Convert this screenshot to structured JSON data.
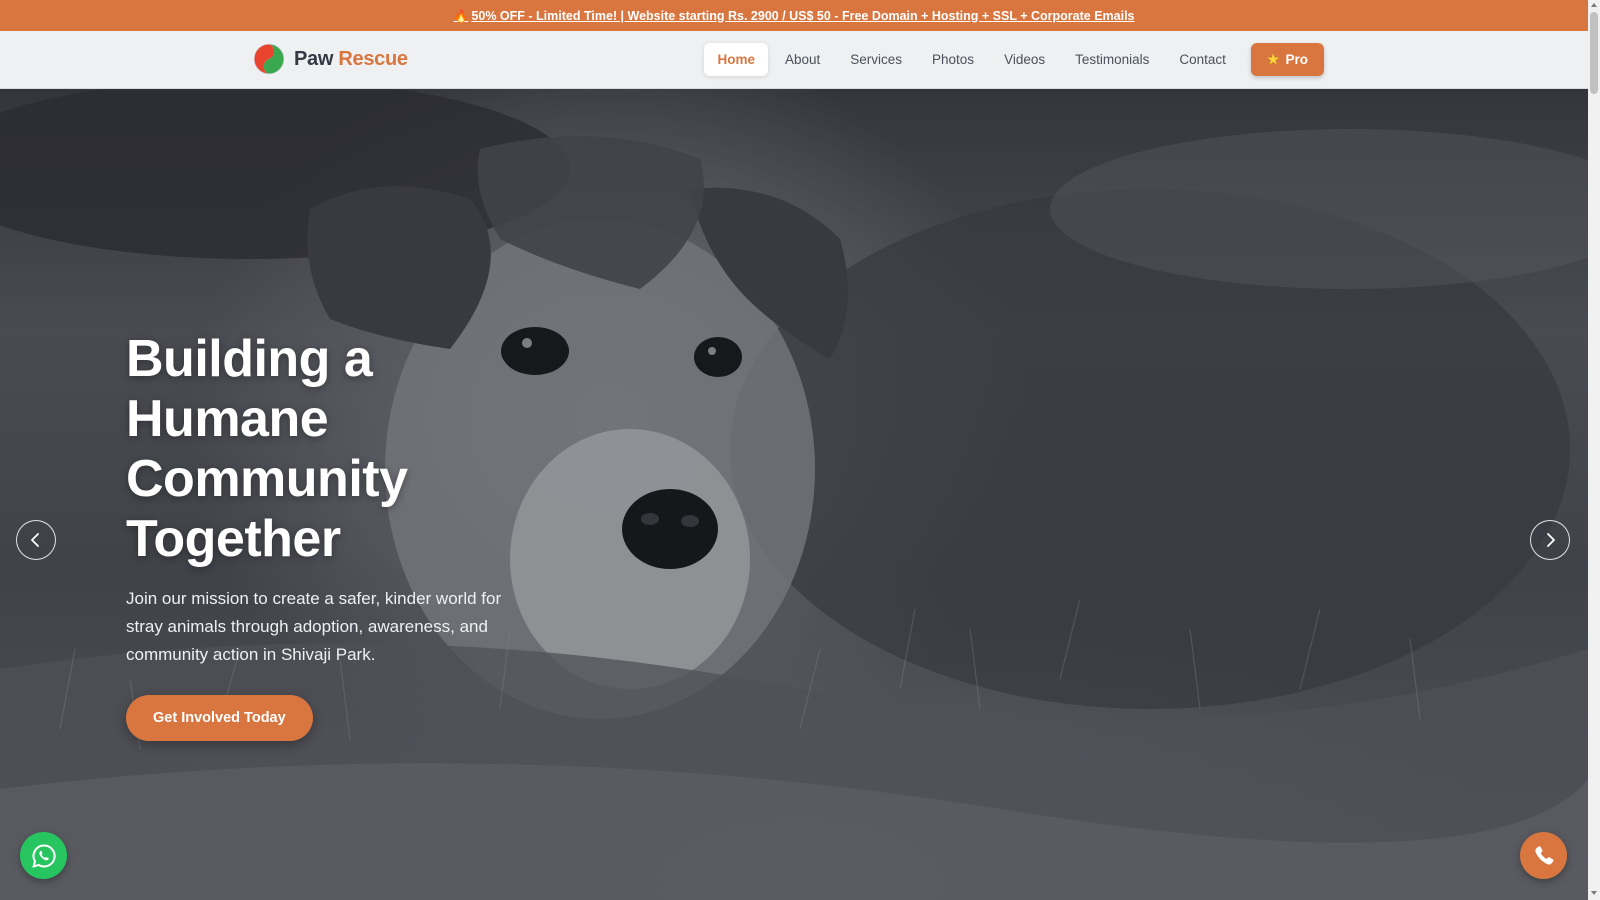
{
  "promo": {
    "icon": "flame-icon",
    "text": "50% OFF - Limited Time! | Website starting Rs. 2900 / US$ 50 - Free Domain + Hosting + SSL + Corporate Emails"
  },
  "brand": {
    "name_part1": "Paw",
    "name_part2": "Rescue",
    "logo_colors": [
      "#e8442e",
      "#3aa84f"
    ]
  },
  "nav": {
    "items": [
      {
        "label": "Home",
        "active": true
      },
      {
        "label": "About"
      },
      {
        "label": "Services"
      },
      {
        "label": "Photos"
      },
      {
        "label": "Videos"
      },
      {
        "label": "Testimonials"
      },
      {
        "label": "Contact"
      }
    ],
    "pro_label": "Pro",
    "pro_icon": "star-icon"
  },
  "hero": {
    "title_lines": [
      "Building a",
      "Humane",
      "Community",
      "Together"
    ],
    "subtitle": "Join our mission to create a safer, kinder world for stray animals through adoption, awareness, and community action in Shivaji Park.",
    "cta_label": "Get Involved Today",
    "background": "puppy lying in grass (grayscale photo)"
  },
  "carousel": {
    "prev_icon": "chevron-left-icon",
    "next_icon": "chevron-right-icon"
  },
  "floating": {
    "whatsapp_icon": "whatsapp-icon",
    "call_icon": "phone-icon"
  },
  "colors": {
    "accent": "#d9763f",
    "whatsapp": "#27c55f",
    "nav_bg": "#eef0f2"
  }
}
